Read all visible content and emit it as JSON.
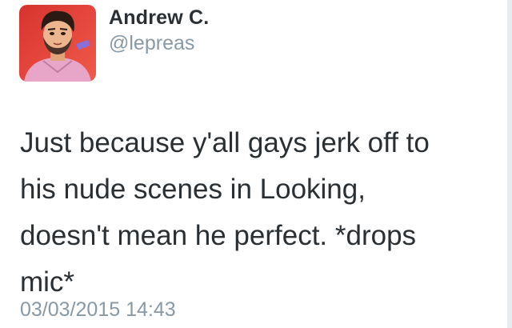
{
  "tweet": {
    "author": {
      "display_name": "Andrew C.",
      "handle": "@lepreas",
      "avatar": "cartoon-profile-avatar"
    },
    "text": "Just because y'all gays jerk off to\nhis nude scenes in Looking,\ndoesn't mean he perfect. *drops\nmic*",
    "timestamp": "03/03/2015 14:43"
  },
  "colors": {
    "text": "#292f33",
    "muted": "#8899a6",
    "avatar_bg": "#e0463d"
  }
}
